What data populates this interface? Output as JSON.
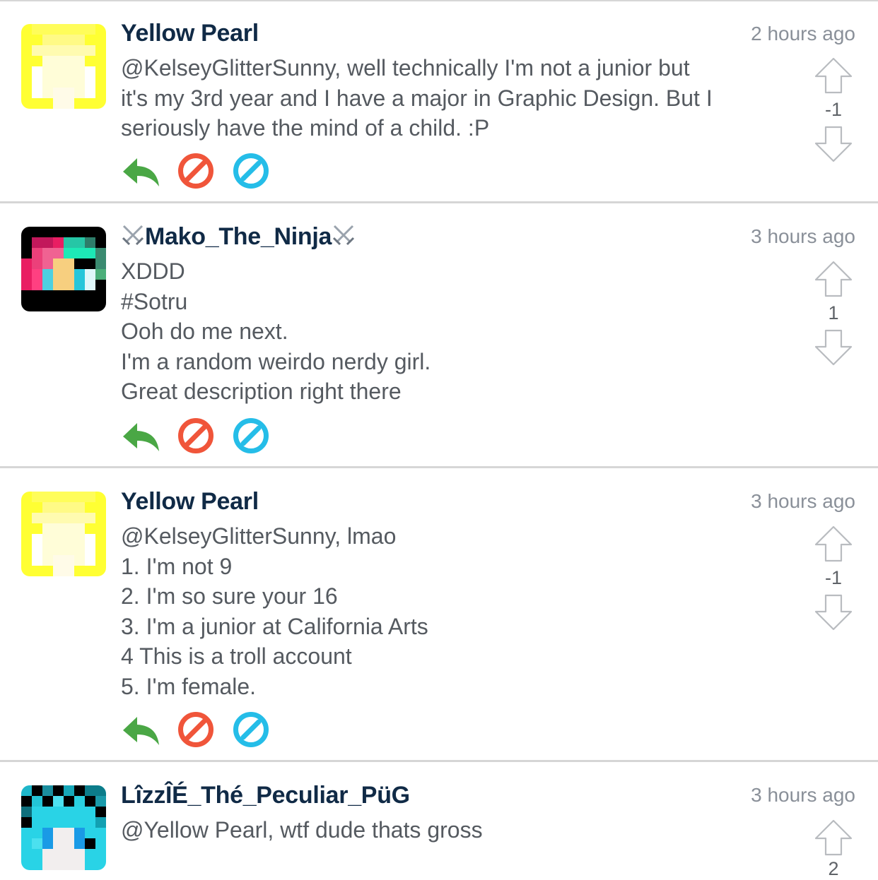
{
  "comments": [
    {
      "username": "Yellow Pearl",
      "timestamp": "2 hours ago",
      "lines": [
        "@KelseyGlitterSunny, well technically I'm not a junior but",
        "it's my 3rd year and I have a major in Graphic Design. But I",
        "seriously have the mind of a child. :P"
      ],
      "score": "-1",
      "avatar": "yellow-pixel-avatar"
    },
    {
      "username": "Mako_The_Ninja",
      "username_decoration": "crossed-swords-icon",
      "timestamp": "3 hours ago",
      "lines": [
        "XDDD",
        "#Sotru",
        "Ooh do me next.",
        "I'm a random weirdo nerdy girl.",
        "Great description right there"
      ],
      "score": "1",
      "avatar": "pink-teal-pixel-avatar"
    },
    {
      "username": "Yellow Pearl",
      "timestamp": "3 hours ago",
      "lines": [
        "@KelseyGlitterSunny, lmao",
        "1. I'm not 9",
        "2. I'm so sure your 16",
        "3. I'm a junior at California Arts",
        "4 This is a troll account",
        "5. I'm female."
      ],
      "score": "-1",
      "avatar": "yellow-pixel-avatar"
    },
    {
      "username": "LîzzÎÉ_Thé_Peculiar_PüG",
      "timestamp": "3 hours ago",
      "lines": [
        "@Yellow Pearl, wtf dude thats gross"
      ],
      "score": "2",
      "avatar": "cyan-pixel-avatar"
    }
  ],
  "icons": {
    "reply": "reply-arrow-icon",
    "block": "block-icon",
    "flag": "flag-icon",
    "upvote": "upvote-arrow-icon",
    "downvote": "downvote-arrow-icon"
  },
  "colors": {
    "username": "#102a46",
    "timestamp": "#8a9099",
    "body": "#555a60",
    "reply": "#4aa745",
    "block": "#f0553a",
    "flag": "#25bde8",
    "divider": "#d6d6d6"
  }
}
